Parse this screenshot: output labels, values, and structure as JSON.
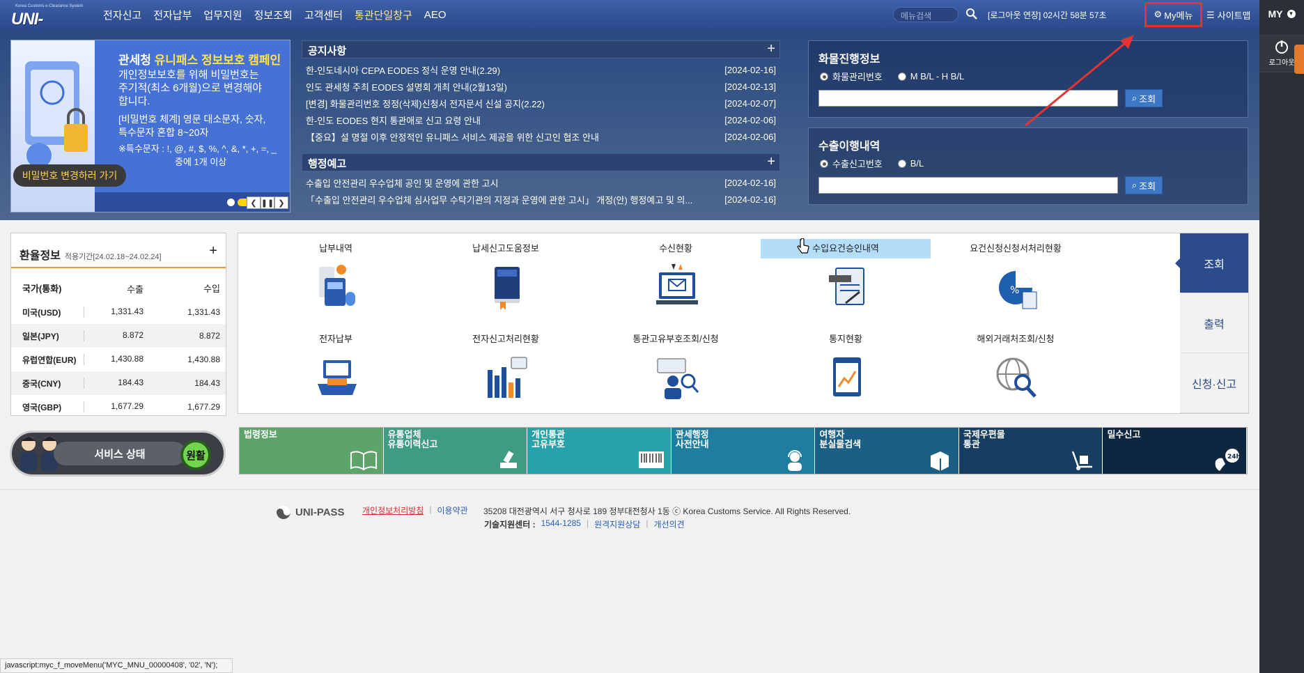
{
  "header": {
    "logo_sub": "Korea Customs e-Clearance System",
    "logo_main": "UNI-PASS",
    "nav": [
      "전자신고",
      "전자납부",
      "업무지원",
      "정보조회",
      "고객센터",
      "통관단일창구",
      "AEO"
    ],
    "search_placeholder": "메뉴검색",
    "logout_timer": "[로그아웃 연장] 02시간 58분 57초",
    "my_menu": "My메뉴",
    "sitemap": "사이트맵"
  },
  "right_panel": {
    "my": "MY",
    "logout": "로그아웃"
  },
  "campaign": {
    "title_a": "관세청 ",
    "title_b": "유니패스 정보보호 캠페인",
    "line1": "개인정보보호를 위해 비밀번호는",
    "line2": "주기적(최소 6개월)으로 변경해야",
    "line3": "합니다.",
    "line4": "[비밀번호 체계] 영문 대소문자, 숫자,",
    "line5": "특수문자 혼합 8~20자",
    "line6": "※특수문자 : !, @, #, $, %, ^, &, *, +, =, _",
    "line7": "중에 1개 이상",
    "button": "비밀번호 변경하러 가기"
  },
  "notices": {
    "title": "공지사항",
    "items": [
      {
        "title": "한-인도네시아 CEPA EODES 정식 운영 안내(2.29)",
        "date": "[2024-02-16]"
      },
      {
        "title": "인도 관세청 주최 EODES 설명회 개최 안내(2월13일)",
        "date": "[2024-02-13]"
      },
      {
        "title": "[변경] 화물관리번호 정정(삭제)신청서 전자문서 신설 공지(2.22)",
        "date": "[2024-02-07]"
      },
      {
        "title": "한-인도 EODES 현지 통관애로 신고 요령 안내",
        "date": "[2024-02-06]"
      },
      {
        "title": "【중요】설 명절 이후 안정적인 유니패스 서비스 제공을 위한 신고인 협조 안내",
        "date": "[2024-02-06]"
      }
    ]
  },
  "admin_notices": {
    "title": "행정예고",
    "items": [
      {
        "title": "수출입 안전관리 우수업체 공인 및 운영에 관한 고시",
        "date": "[2024-02-16]"
      },
      {
        "title": "「수출입 안전관리 우수업체 심사업무 수탁기관의 지정과 운영에 관한 고시」 개정(안) 행정예고 및 의...",
        "date": "[2024-02-16]"
      }
    ]
  },
  "cargo": {
    "title": "화물진행정보",
    "opt1": "화물관리번호",
    "opt2": "M B/L - H B/L",
    "button": "조회"
  },
  "export": {
    "title": "수출이행내역",
    "opt1": "수출신고번호",
    "opt2": "B/L",
    "button": "조회"
  },
  "exchange": {
    "title": "환율정보",
    "period": "적용기간[24.02.18~24.02.24]",
    "headers": [
      "국가(통화)",
      "수출",
      "수입"
    ],
    "rows": [
      [
        "미국(USD)",
        "1,331.43",
        "1,331.43"
      ],
      [
        "일본(JPY)",
        "8.872",
        "8.872"
      ],
      [
        "유럽연합(EUR)",
        "1,430.88",
        "1,430.88"
      ],
      [
        "중국(CNY)",
        "184.43",
        "184.43"
      ],
      [
        "영국(GBP)",
        "1,677.29",
        "1,677.29"
      ]
    ]
  },
  "service": {
    "label": "서비스 상태",
    "status": "원활"
  },
  "quick": {
    "items": [
      {
        "l1": "납부내역",
        "l2": ""
      },
      {
        "l1": "납세신고",
        "l2": "도움정보"
      },
      {
        "l1": "수신현황",
        "l2": ""
      },
      {
        "l1": "수입요건",
        "l2": "승인내역"
      },
      {
        "l1": "요건신청신청서",
        "l2": "처리현황"
      },
      {
        "l1": "전자납부",
        "l2": ""
      },
      {
        "l1": "전자신고",
        "l2": "처리현황"
      },
      {
        "l1": "통관고유부호",
        "l2": "조회/신청"
      },
      {
        "l1": "통지현황",
        "l2": ""
      },
      {
        "l1": "해외거래처",
        "l2": "조회/신청"
      }
    ],
    "tabs": [
      "조회",
      "출력",
      "신청·신고"
    ]
  },
  "banners": [
    {
      "l1": "법령정보",
      "l2": "",
      "color": "#5da36a"
    },
    {
      "l1": "유통업체",
      "l2": "유통이력신고",
      "color": "#3d9c82"
    },
    {
      "l1": "개인통관",
      "l2": "고유부호",
      "color": "#26a2a8"
    },
    {
      "l1": "관세행정",
      "l2": "사전안내",
      "color": "#1f7ea0"
    },
    {
      "l1": "여행자",
      "l2": "분실물검색",
      "color": "#1c5f86"
    },
    {
      "l1": "국제우편물",
      "l2": "통관",
      "color": "#153e62"
    },
    {
      "l1": "밀수신고",
      "l2": "",
      "color": "#0e2640"
    }
  ],
  "footer": {
    "brand": "UNI-PASS",
    "privacy": "개인정보처리방침",
    "terms": "이용약관",
    "address": "35208 대전광역시 서구 청사로 189 정부대전청사 1동 ⓒ Korea Customs Service. All Rights Reserved.",
    "tech_label": "기술지원센터 :",
    "tech_phone": "1544-1285",
    "remote": "원격지원상담",
    "feedback": "개선의견"
  },
  "statusbar": "javascript:myc_f_moveMenu('MYC_MNU_00000408', '02', 'N');"
}
